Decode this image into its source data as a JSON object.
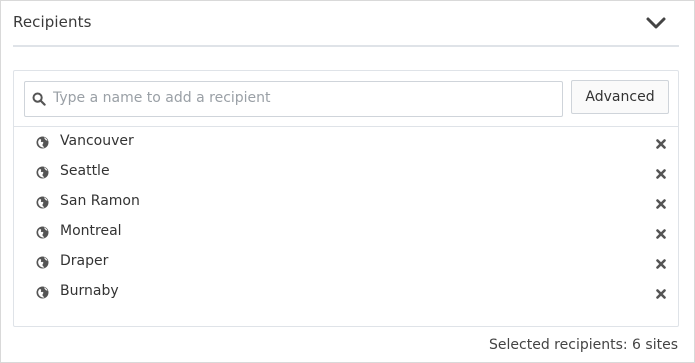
{
  "section": {
    "title": "Recipients",
    "toggle_icon": "chevron-down-icon"
  },
  "search": {
    "placeholder": "Type a name to add a recipient",
    "value": "",
    "icon": "search-icon"
  },
  "advanced_label": "Advanced",
  "recipients": [
    {
      "name": "Vancouver",
      "icon": "globe-icon"
    },
    {
      "name": "Seattle",
      "icon": "globe-icon"
    },
    {
      "name": "San Ramon",
      "icon": "globe-icon"
    },
    {
      "name": "Montreal",
      "icon": "globe-icon"
    },
    {
      "name": "Draper",
      "icon": "globe-icon"
    },
    {
      "name": "Burnaby",
      "icon": "globe-icon"
    }
  ],
  "remove_icon": "close-icon",
  "footer": {
    "summary": "Selected recipients: 6 sites"
  },
  "colors": {
    "border": "#dfe3e8",
    "text": "#333333",
    "placeholder": "#9aa0a6",
    "icon": "#555555"
  }
}
